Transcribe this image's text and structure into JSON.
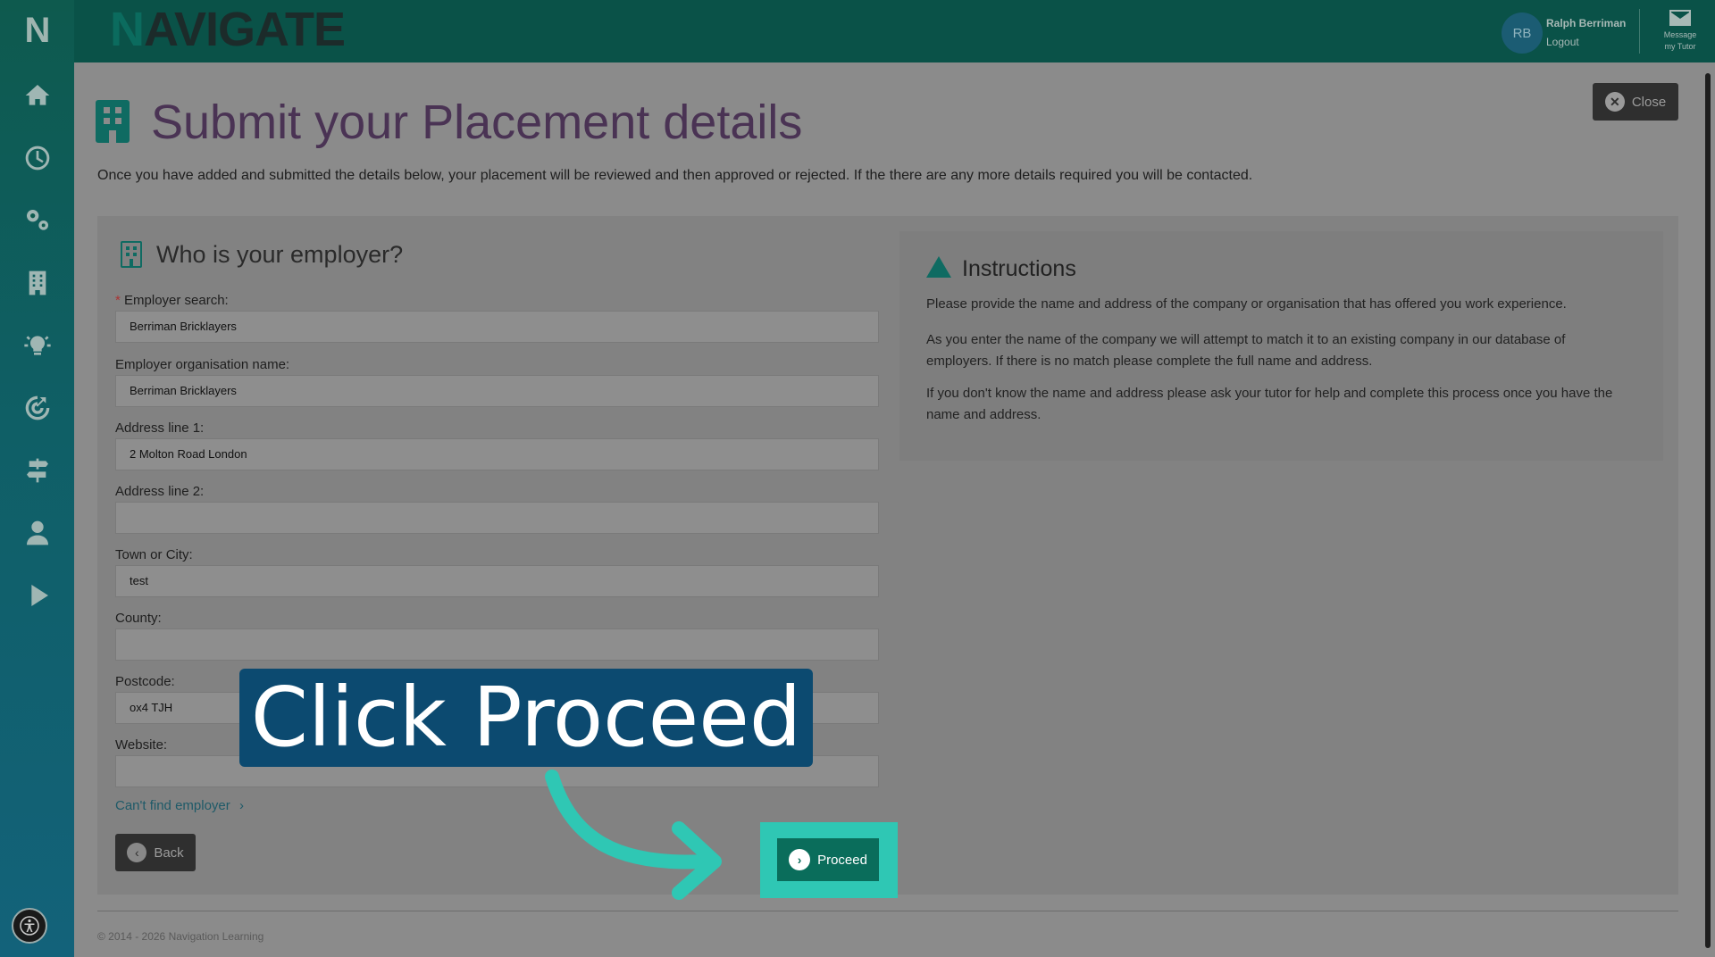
{
  "app": {
    "brand": "AVIGATE",
    "brand_initial": "N",
    "logo_letter": "N"
  },
  "user": {
    "initials": "RB",
    "name": "Ralph Berriman",
    "logout": "Logout",
    "message_line1": "Message",
    "message_line2": "my Tutor"
  },
  "sidebar": {
    "items": [
      {
        "icon": "home-icon"
      },
      {
        "icon": "clock-icon"
      },
      {
        "icon": "gears-icon"
      },
      {
        "icon": "building-icon"
      },
      {
        "icon": "lightbulb-icon"
      },
      {
        "icon": "target-icon"
      },
      {
        "icon": "signpost-icon"
      },
      {
        "icon": "user-icon"
      },
      {
        "icon": "play-icon"
      }
    ]
  },
  "page": {
    "title": "Submit your Placement details",
    "close_label": "Close",
    "intro": "Once you have added and submitted the details below, your placement will be reviewed and then approved or rejected. If the there are any more details required you will be contacted."
  },
  "form": {
    "section_title": "Who is your employer?",
    "fields": [
      {
        "label": "Employer search:",
        "value": "Berriman Bricklayers"
      },
      {
        "label": "Employer organisation name:",
        "value": "Berriman Bricklayers"
      },
      {
        "label": "Address line 1:",
        "value": "2 Molton Road London"
      },
      {
        "label": "Address line 2:",
        "value": ""
      },
      {
        "label": "Town or City:",
        "value": "test"
      },
      {
        "label": "County:",
        "value": ""
      },
      {
        "label": "Postcode:",
        "value": "ox4 TJH"
      },
      {
        "label": "Website:",
        "value": ""
      }
    ],
    "required_marker": "*",
    "cant_find": "Can't find employer",
    "back_label": "Back",
    "proceed_label": "Proceed"
  },
  "instructions": {
    "title": "Instructions",
    "p1": "Please provide the name and address of the company or organisation that has offered you work experience.",
    "p2": "As you enter the name of the company we will attempt to match it to an existing company in our database of employers. If there is no match please complete the full name and address.",
    "p3": "If you don't know the name and address please ask your tutor for help and complete this process once you have the name and address."
  },
  "footer": {
    "copyright": "© 2014 - 2026 Navigation Learning"
  },
  "callout": {
    "text": "Click Proceed"
  },
  "colors": {
    "accent": "#0f6b62",
    "callout_bg": "#0c4a70",
    "highlight": "#2fc7b4",
    "title": "#4a3354"
  }
}
